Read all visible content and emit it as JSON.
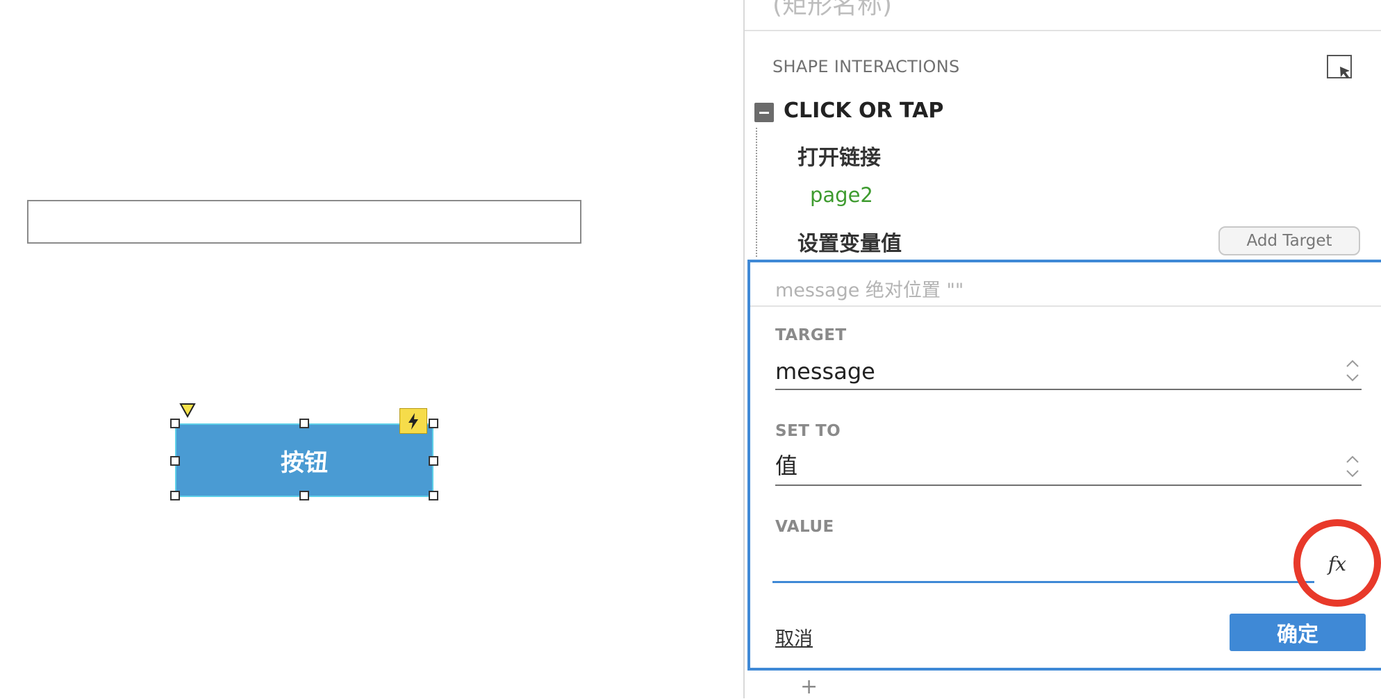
{
  "canvas": {
    "button_label": "按钮"
  },
  "panel": {
    "header_cut": "(矩形名称)",
    "section_title": "SHAPE INTERACTIONS",
    "event": {
      "title": "CLICK OR TAP",
      "actions": [
        {
          "label": "打开链接",
          "target": "page2"
        },
        {
          "label": "设置变量值"
        }
      ],
      "add_target_label": "Add Target"
    },
    "editor": {
      "summary": "message 绝对位置 \"\"",
      "target_label": "TARGET",
      "target_value": "message",
      "set_to_label": "SET TO",
      "set_to_value": "值",
      "value_label": "VALUE",
      "value_value": "",
      "fx_label": "fx",
      "cancel_label": "取消",
      "confirm_label": "确定"
    },
    "add_action_symbol": "+"
  },
  "colors": {
    "accent_blue": "#3f89d6",
    "button_fill": "#4a9bd3",
    "link_green": "#3e9b2f",
    "highlight_red": "#e8392a",
    "badge_yellow": "#f6dc4a"
  },
  "icons": {
    "collapse": "minus-icon",
    "section": "pointer-select-icon",
    "badge": "lightning-icon",
    "stepper": "chevron-up-down-icon",
    "formula": "function-fx-icon"
  }
}
